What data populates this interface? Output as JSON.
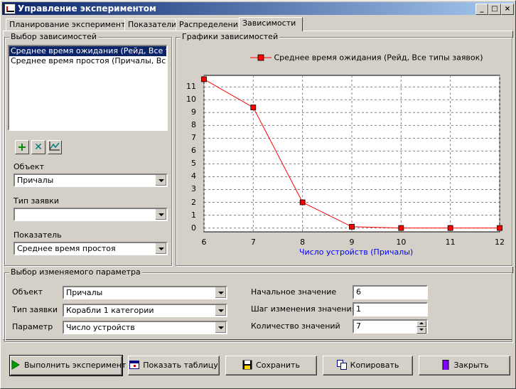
{
  "window": {
    "title": "Управление экспериментом",
    "minimize": "_",
    "maximize": "□",
    "close": "×"
  },
  "tabs": [
    {
      "label": "Планирование эксперимента"
    },
    {
      "label": "Показатели"
    },
    {
      "label": "Распределения"
    },
    {
      "label": "Зависимости",
      "active": true
    }
  ],
  "selection_group": {
    "legend": "Выбор зависимостей",
    "items": [
      {
        "label": "Среднее время ожидания (Рейд, Все типы заявок)",
        "selected": true
      },
      {
        "label": "Среднее время простоя (Причалы, Все типы заявок)",
        "selected": false
      }
    ],
    "toolbar": {
      "add_icon": "plus-icon",
      "delete_icon": "x-icon",
      "chart_icon": "chart-icon"
    },
    "object_label": "Объект",
    "object_value": "Причалы",
    "request_type_label": "Тип заявки",
    "request_type_value": "",
    "indicator_label": "Показатель",
    "indicator_value": "Среднее время простоя"
  },
  "chart_group": {
    "legend": "Графики зависимостей"
  },
  "chart_data": {
    "type": "line",
    "xlabel": "Число устройств (Причалы)",
    "ylabel": "",
    "x": [
      6,
      7,
      8,
      9,
      10,
      11,
      12
    ],
    "series": [
      {
        "name": "Среднее время ожидания (Рейд, Все типы заявок)",
        "values": [
          11.6,
          9.4,
          2.0,
          0.1,
          0.0,
          0.0,
          0.0
        ],
        "color": "#ff0000"
      }
    ],
    "xlim": [
      6,
      12
    ],
    "ylim": [
      -0.3,
      11.9
    ],
    "xticks": [
      6,
      7,
      8,
      9,
      10,
      11,
      12
    ],
    "yticks": [
      0,
      1,
      2,
      3,
      4,
      5,
      6,
      7,
      8,
      9,
      10,
      11
    ],
    "grid": true,
    "legend_position": "top"
  },
  "param_group": {
    "legend": "Выбор изменяемого параметра",
    "object_label": "Объект",
    "object_value": "Причалы",
    "request_type_label": "Тип заявки",
    "request_type_value": "Корабли 1 категории",
    "parameter_label": "Параметр",
    "parameter_value": "Число устройств",
    "start_label": "Начальное значение",
    "start_value": "6",
    "step_label": "Шаг изменения значения",
    "step_value": "1",
    "count_label": "Количество значений",
    "count_value": "7"
  },
  "buttons": {
    "run": "Выполнить эксперимент",
    "show_table": "Показать таблицу",
    "save": "Сохранить",
    "copy": "Копировать",
    "close": "Закрыть"
  }
}
